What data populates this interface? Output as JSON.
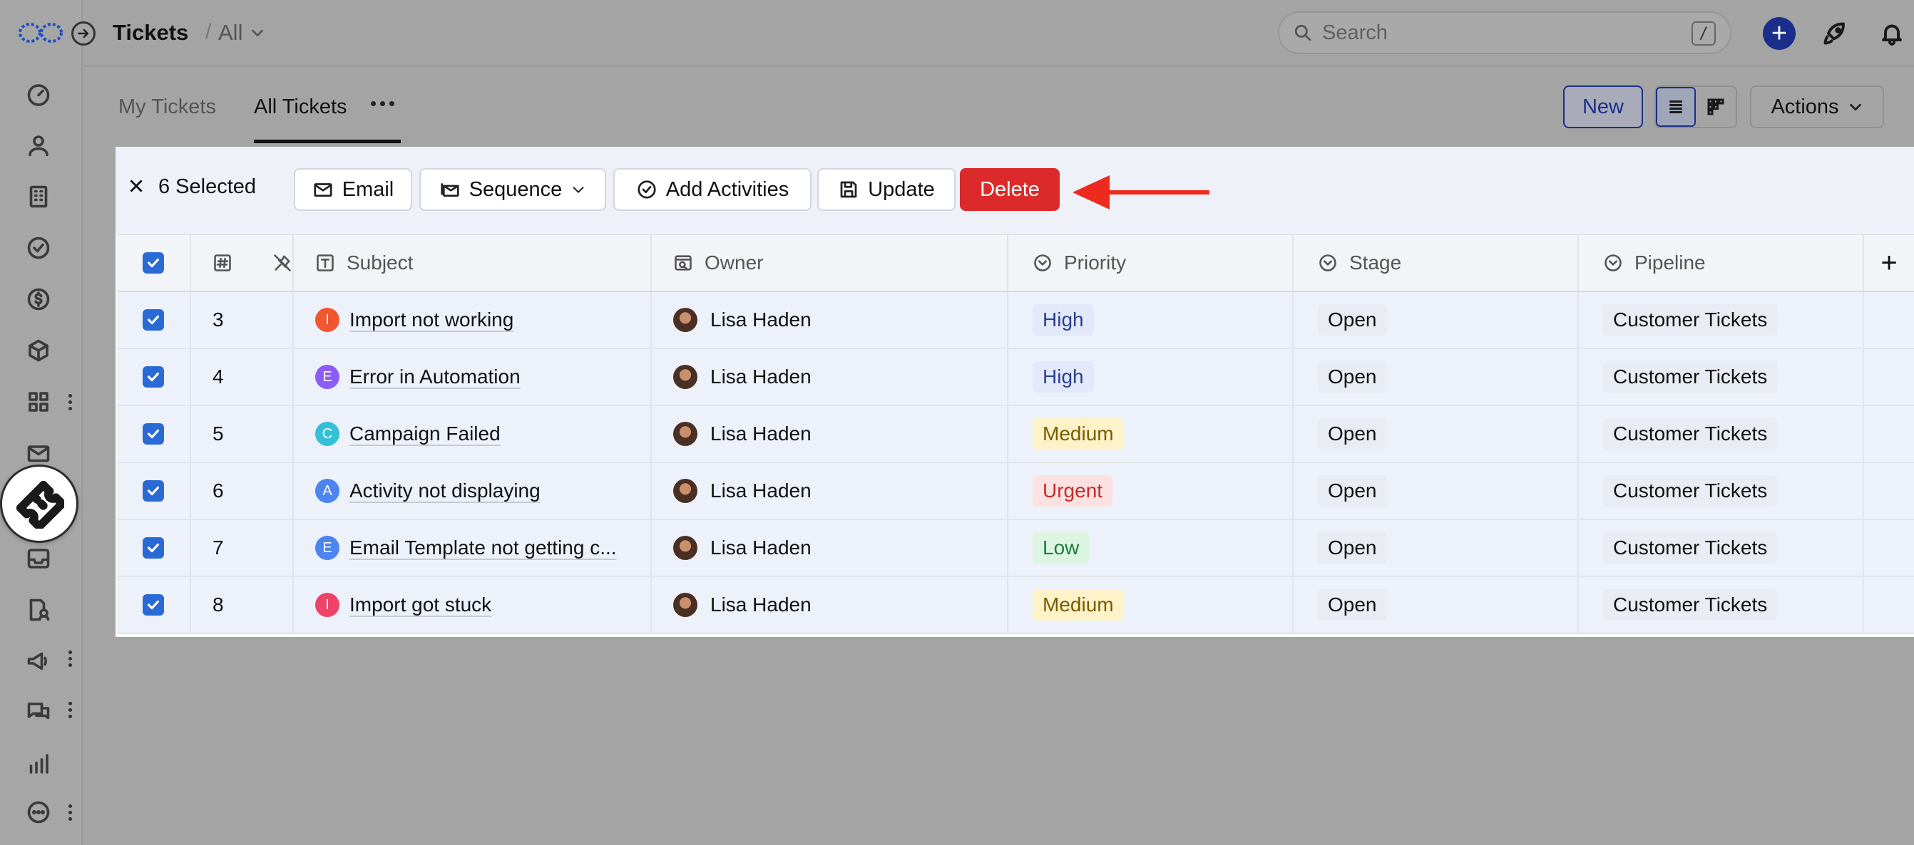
{
  "header": {
    "title": "Tickets",
    "separator": "/",
    "view_label": "All",
    "search_placeholder": "Search",
    "search_shortcut": "/",
    "add_label": "+"
  },
  "tabs": [
    {
      "label": "My Tickets",
      "active": false
    },
    {
      "label": "All Tickets",
      "active": true
    }
  ],
  "toolbar": {
    "new_label": "New",
    "actions_label": "Actions"
  },
  "bulk_bar": {
    "selected_label": "6 Selected",
    "email_label": "Email",
    "sequence_label": "Sequence",
    "add_activities_label": "Add Activities",
    "update_label": "Update",
    "delete_label": "Delete"
  },
  "table": {
    "columns": [
      {
        "label": "#",
        "icon": "hash-icon"
      },
      {
        "label": "Subject",
        "icon": "text-icon"
      },
      {
        "label": "Owner",
        "icon": "user-card-icon"
      },
      {
        "label": "Priority",
        "icon": "dropdown-circle-icon"
      },
      {
        "label": "Stage",
        "icon": "dropdown-circle-icon"
      },
      {
        "label": "Pipeline",
        "icon": "dropdown-circle-icon"
      }
    ],
    "add_column_label": "+",
    "rows": [
      {
        "id": "3",
        "letter": "I",
        "letter_color": "#f0562f",
        "subject": "Import not working",
        "owner": "Lisa Haden",
        "priority": "High",
        "stage": "Open",
        "pipeline": "Customer Tickets"
      },
      {
        "id": "4",
        "letter": "E",
        "letter_color": "#8b5cf6",
        "subject": "Error in Automation",
        "owner": "Lisa Haden",
        "priority": "High",
        "stage": "Open",
        "pipeline": "Customer Tickets"
      },
      {
        "id": "5",
        "letter": "C",
        "letter_color": "#35c0d8",
        "subject": "Campaign Failed",
        "owner": "Lisa Haden",
        "priority": "Medium",
        "stage": "Open",
        "pipeline": "Customer Tickets"
      },
      {
        "id": "6",
        "letter": "A",
        "letter_color": "#4c84f0",
        "subject": "Activity not displaying",
        "owner": "Lisa Haden",
        "priority": "Urgent",
        "stage": "Open",
        "pipeline": "Customer Tickets"
      },
      {
        "id": "7",
        "letter": "E",
        "letter_color": "#4c84f0",
        "subject": "Email Template not getting c...",
        "owner": "Lisa Haden",
        "priority": "Low",
        "stage": "Open",
        "pipeline": "Customer Tickets"
      },
      {
        "id": "8",
        "letter": "I",
        "letter_color": "#f0436a",
        "subject": "Import got stuck",
        "owner": "Lisa Haden",
        "priority": "Medium",
        "stage": "Open",
        "pipeline": "Customer Tickets"
      }
    ]
  },
  "priority_colors": {
    "High": {
      "bg": "#e3e9fb",
      "fg": "#2a3f8f"
    },
    "Medium": {
      "bg": "#fdf2c8",
      "fg": "#7a5b00"
    },
    "Urgent": {
      "bg": "#fde1e1",
      "fg": "#c22b2b"
    },
    "Low": {
      "bg": "#dcf5e3",
      "fg": "#1f7a3c"
    }
  },
  "colors": {
    "accent": "#1b2f8a",
    "delete": "#dc2a2a",
    "checkbox": "#2a6ad6",
    "annotation_arrow": "#ee2a1f"
  }
}
